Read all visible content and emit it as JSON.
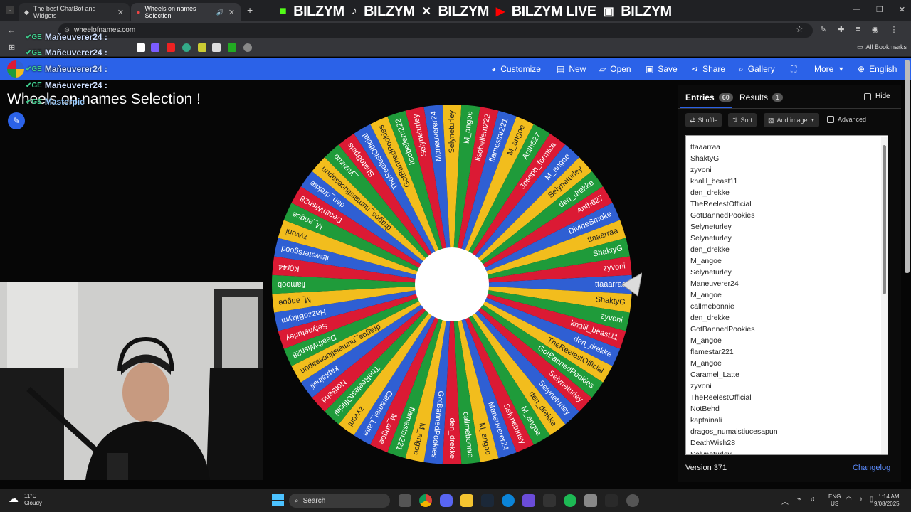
{
  "browser": {
    "tabs": [
      {
        "label": "The best ChatBot and Widgets"
      },
      {
        "label": "Wheels on names Selection"
      }
    ],
    "address": "wheelofnames.com",
    "all_bookmarks": "All Bookmarks",
    "stream_banner": [
      "BILZYM",
      "BILZYM",
      "BILZYM",
      "BILZYM LIVE",
      "BILZYM"
    ]
  },
  "chat_overlay": [
    {
      "user": "Mañeuverer24 :"
    },
    {
      "user": "Mañeuverer24 :"
    },
    {
      "user": "Mañeuverer24 :"
    },
    {
      "user": "Mañeuverer24 :"
    },
    {
      "user": "Masterpie"
    }
  ],
  "app": {
    "nav": {
      "customize": "Customize",
      "new": "New",
      "open": "Open",
      "save": "Save",
      "share": "Share",
      "gallery": "Gallery",
      "more": "More",
      "language": "English"
    },
    "title": "Wheels on names Selection !",
    "wheel": {
      "colors": [
        "#2f5fd3",
        "#f2bd1d",
        "#1f9b3a",
        "#db1a34"
      ],
      "labels": [
        "ttaaarraa",
        "ShaktyG",
        "zyvoni",
        "khalil_beast11",
        "den_drekke",
        "TheReelestOfficial",
        "GotBannedPookies",
        "Selyneturley",
        "Selyneturley",
        "den_drekke",
        "M_angoe",
        "Selyneturley",
        "Maneuverer24",
        "M_angoe",
        "callmebonnie",
        "den_drekke",
        "GotBannedPookies",
        "M_angoe",
        "flamestar221",
        "M_angoe",
        "Caramel_Latte",
        "zyvoni",
        "TheReelestOfficial",
        "NotBehd",
        "kaptainali",
        "dragos_numaistiucesapun",
        "DeathWish28",
        "Selyneturley",
        "HazzoBilzym",
        "M_angoe",
        "flamoob",
        "K0r44",
        "itswatersgood",
        "zyvoni",
        "M_angoe",
        "DeathWish28",
        "den_drekke",
        "dragos_numaistiucesapun",
        "_yuzizuo",
        "ShatoBpels",
        "TheReelestOfficial",
        "GotBannedPookies",
        "lisobellem222",
        "Selyneturley",
        "Maneuverer24",
        "Selyneturley",
        "M_angoe",
        "lisobellem222",
        "flamestar221",
        "M_angoe",
        "Anth627",
        "Joseph_formica",
        "M_angoe",
        "Selyneturley",
        "den_drekke",
        "Anth627",
        "DivineSmoke",
        "ttaaarraa",
        "ShaktyG",
        "zyvoni"
      ]
    },
    "panel": {
      "entries_tab": "Entries",
      "entries_count": "60",
      "results_tab": "Results",
      "results_count": "1",
      "hide": "Hide",
      "shuffle": "Shuffle",
      "sort": "Sort",
      "add_image": "Add image",
      "advanced": "Advanced",
      "entries": [
        "ttaaarraa",
        "ShaktyG",
        "zyvoni",
        "khalil_beast11",
        "den_drekke",
        "TheReelestOfficial",
        "GotBannedPookies",
        "Selyneturley",
        "Selyneturley",
        "den_drekke",
        "M_angoe",
        "Selyneturley",
        "Maneuverer24",
        "M_angoe",
        "callmebonnie",
        "den_drekke",
        "GotBannedPookies",
        "M_angoe",
        "flamestar221",
        "M_angoe",
        "Caramel_Latte",
        "zyvoni",
        "TheReelestOfficial",
        "NotBehd",
        "kaptainali",
        "dragos_numaistiucesapun",
        "DeathWish28",
        "Selyneturley"
      ],
      "version": "Version 371",
      "changelog": "Changelog"
    }
  },
  "taskbar": {
    "weather_temp": "11°C",
    "weather_desc": "Cloudy",
    "search": "Search",
    "lang": "ENG",
    "region": "US",
    "time": "1:14 AM",
    "date": "9/08/2025"
  }
}
